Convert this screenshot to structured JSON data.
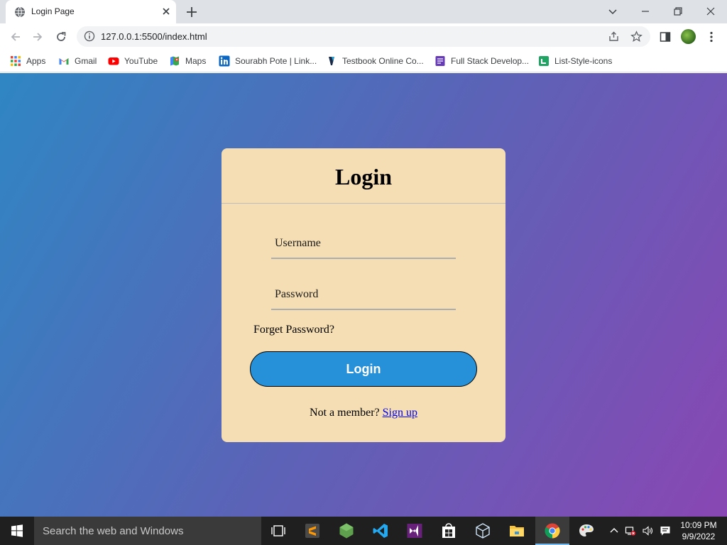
{
  "browser": {
    "tab_title": "Login Page",
    "url": "127.0.0.1:5500/index.html",
    "bookmarks": [
      {
        "label": "Apps",
        "icon": "apps-grid-icon"
      },
      {
        "label": "Gmail",
        "icon": "gmail-icon"
      },
      {
        "label": "YouTube",
        "icon": "youtube-icon"
      },
      {
        "label": "Maps",
        "icon": "maps-icon"
      },
      {
        "label": "Sourabh Pote | Link...",
        "icon": "linkedin-icon"
      },
      {
        "label": "Testbook Online Co...",
        "icon": "testbook-icon"
      },
      {
        "label": "Full Stack Develop...",
        "icon": "course-icon"
      },
      {
        "label": "List-Style-icons",
        "icon": "list-style-icon"
      }
    ]
  },
  "page": {
    "title": "Login",
    "username_placeholder": "Username",
    "password_placeholder": "Password",
    "forgot_password": "Forget Password?",
    "login_button": "Login",
    "signup_prompt": "Not a member?",
    "signup_link": "Sign up",
    "colors": {
      "gradient_start": "#2f86c3",
      "gradient_end": "#8947b4",
      "card": "#f5deb3",
      "button": "#2691d9"
    }
  },
  "taskbar": {
    "search_placeholder": "Search the web and Windows",
    "time": "10:09 PM",
    "date": "9/9/2022"
  }
}
